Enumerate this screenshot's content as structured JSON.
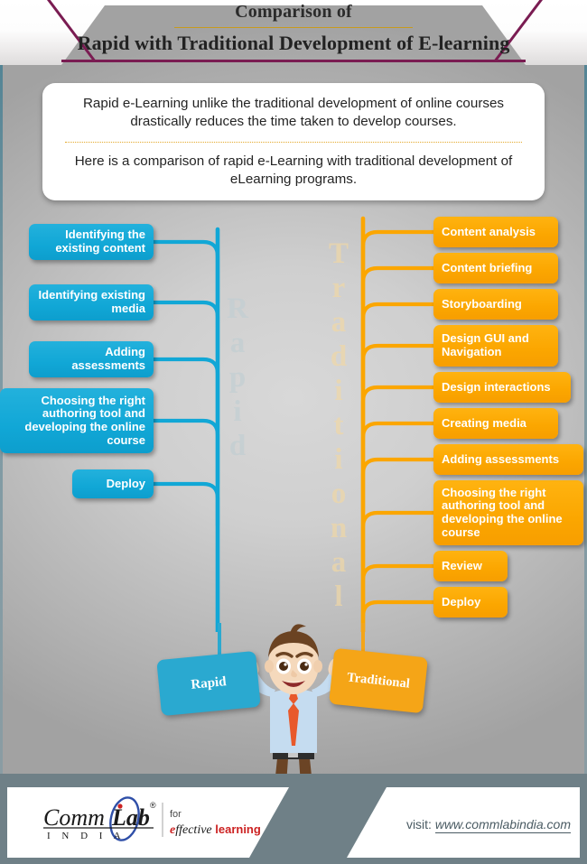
{
  "header": {
    "line1": "Comparison of",
    "line2": "Rapid with Traditional Development of E-learning",
    "border_color": "#7a1c52",
    "divider_color": "#c79a1e"
  },
  "intro": {
    "paragraph1": "Rapid e-Learning unlike the traditional development of online courses drastically reduces the time taken to develop courses.",
    "paragraph2": "Here is a comparison of rapid e-Learning with traditional development of eLearning programs."
  },
  "watermarks": {
    "left": "Rapid",
    "right": "Traditional"
  },
  "rapid": {
    "label": "Rapid",
    "accent": "#11a7d6",
    "steps": [
      "Identifying the existing content",
      "Identifying existing media",
      "Adding assessments",
      "Choosing the right authoring tool and developing the online course",
      "Deploy"
    ]
  },
  "traditional": {
    "label": "Traditional",
    "accent": "#fba600",
    "steps": [
      "Content analysis",
      "Content briefing",
      "Storyboarding",
      "Design GUI and Navigation",
      "Design interactions",
      "Creating media",
      "Adding assessments",
      "Choosing the right authoring tool and developing the online course",
      "Review",
      "Deploy"
    ]
  },
  "footer": {
    "brand_comm": "Comm",
    "brand_lab": "Lab",
    "brand_reg": "®",
    "brand_india": "I  N  D  I  A",
    "tagline_for": "for",
    "tagline_e": "e",
    "tagline_ff": "ff",
    "tagline_ective": "ective",
    "tagline_learning": "learning",
    "visit_label": "visit:",
    "visit_url": "www.commlabindia.com"
  }
}
